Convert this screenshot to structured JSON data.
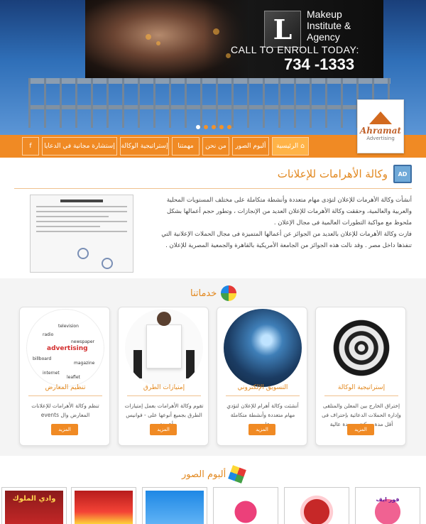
{
  "hero": {
    "brand_letter": "L",
    "brand_line1": "Makeup",
    "brand_line2": "Institute &",
    "brand_line3": "Agency",
    "call": "CALL TO ENROLL TODAY:",
    "phone": "734 -1333"
  },
  "logo": {
    "name": "Ahramat",
    "sub": "Advertising"
  },
  "nav": {
    "home": "الرئيسية",
    "album": "ألبوم الصور",
    "about": "من نحن",
    "mission": "مهمتنا",
    "strategy": "إستراتيجية الوكالة",
    "consult": "إستشارة مجانية في الدعايا",
    "facebook": "f"
  },
  "about": {
    "title": "وكالة الأهرامات للإعلانات",
    "p1": "أنشأت وكالة الأهرمات للإعلان لتؤدى مهام متعددة وأنشطة متكاملة على مختلف المستويات المحلية والعربية والعالمية، وحققت وكالة الأهرمات للإعلان العديد من الإنجازات ، وتطور حجم أعمالها بشكل ملحوظ مع مواكبة التطورات العالمية فى مجال الإعلان .",
    "p2": "فازت وكالة الأهرمات للإعلان بالعديد من الجوائز عن أعمالها المتميزة فى مجال الحملات الإعلانية التي تنفذها داخل مصر . وقد نالت هذه الجوائز من الجامعة الأمريكية بالقاهرة والجمعية المصرية للإعلان ."
  },
  "services": {
    "title": "خدماتنا",
    "cards": [
      {
        "title": "إستراتيجية الوكالة",
        "text": "إختراق الخارج بين المعلن والمتلقى وإدارة الحملات الدعائية بإحتراف فى أقل مدة ممكنة وبجودة عالية",
        "more": "المزيد"
      },
      {
        "title": "التسويق الإلكتروني",
        "text": "أنشئت وكالة أهرام للإعلان لتؤدي مهام متعددة وأنشطة متكاملة على...",
        "more": "المزيد"
      },
      {
        "title": "إمتيازات الطرق",
        "text": "تقوم وكالة الأهرامات بعمل إمتيازات الطرق بجميع أنوعها على - فوانيس أعمدة...",
        "more": "المزيد"
      },
      {
        "title": "تنظيم المعارض",
        "text": "تنظم وكالة الأهرامات للإعلانات المعارض وال events",
        "more": "المزيد"
      }
    ],
    "words": [
      "television",
      "radio",
      "newspaper",
      "advertising",
      "billboard",
      "magazine",
      "internet",
      "leaflet"
    ]
  },
  "gallery": {
    "title": "ألبوم الصور",
    "thumb_texts": [
      "وادي الملوك",
      "",
      "",
      "",
      "",
      "فور ايف"
    ]
  },
  "colors": {
    "orange": "#f08a24",
    "title_orange": "#e2881f"
  }
}
